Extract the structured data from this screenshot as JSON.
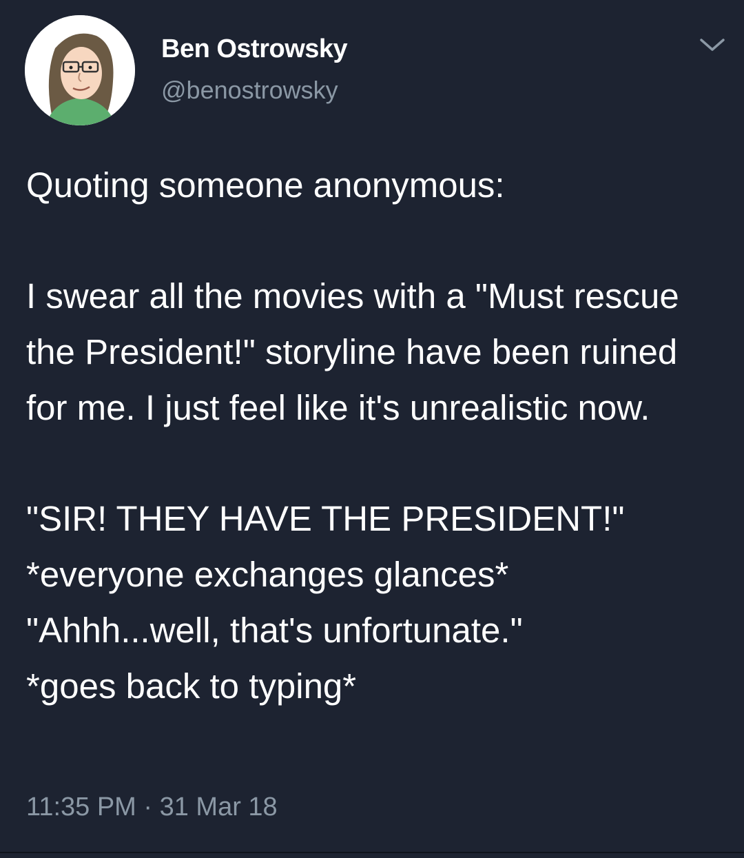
{
  "user": {
    "name": "Ben Ostrowsky",
    "handle": "@benostrowsky",
    "avatar": "cartoon-avatar"
  },
  "menu_icon": "chevron-down-icon",
  "tweet": {
    "lines": [
      "Quoting someone anonymous:",
      "I swear all the movies with a \"Must rescue the President!\" storyline have been ruined for me. I just feel like it's unrealistic now.",
      "\"SIR! THEY HAVE THE PRESIDENT!\"",
      "*everyone exchanges glances*",
      "\"Ahhh...well, that's unfortunate.\"",
      "*goes back to typing*"
    ],
    "timestamp": "11:35 PM · 31 Mar 18"
  },
  "colors": {
    "background": "#1d2331",
    "text": "#ffffff",
    "secondary_text": "#8b98a5"
  }
}
